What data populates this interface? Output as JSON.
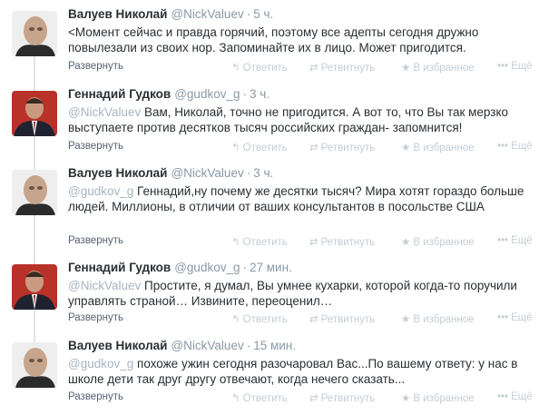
{
  "tweets": [
    {
      "name": "Валуев Николай",
      "handle": "@NickValuev",
      "time": "5 ч.",
      "avatar": "bald-man-avatar",
      "mention": "",
      "text": "<Момент сейчас и правда горячий, поэтому все адепты сегодня дружно повылезали из своих нор. Запоминайте их в лицо. Может пригодится."
    },
    {
      "name": "Геннадий Гудков",
      "handle": "@gudkov_g",
      "time": "3 ч.",
      "avatar": "suited-man-avatar",
      "mention": "@NickValuev",
      "text": "Вам, Николай, точно не пригодится. А вот то, что Вы так мерзко выступаете против десятков тысяч российских граждан- запомнится!"
    },
    {
      "name": "Валуев Николай",
      "handle": "@NickValuev",
      "time": "3 ч.",
      "avatar": "bald-man-avatar",
      "mention": "@gudkov_g",
      "text": "Геннадий,ну почему же десятки тысяч? Мира хотят гораздо больше людей. Миллионы, в отличии от ваших консультантов в посольстве США"
    },
    {
      "name": "Геннадий Гудков",
      "handle": "@gudkov_g",
      "time": "27 мин.",
      "avatar": "suited-man-avatar",
      "mention": "@NickValuev",
      "text": "Простите, я думал, Вы умнее кухарки, которой когда-то поручили управлять страной… Извините, переоценил…"
    },
    {
      "name": "Валуев Николай",
      "handle": "@NickValuev",
      "time": "15 мин.",
      "avatar": "bald-man-avatar",
      "mention": "@gudkov_g",
      "text": "похоже ужин сегодня разочаровал Вас...По вашему ответу: у нас в школе дети так друг другу отвечают, когда нечего сказать..."
    }
  ],
  "actions": {
    "expand": "Развернуть",
    "reply": "Ответить",
    "retweet": "Ретвитнуть",
    "favorite": "В избранное",
    "more": "Ещё"
  },
  "colors": {
    "name": "#292f33",
    "meta": "#8899a6",
    "action": "#c4cdd5",
    "expand": "#556270"
  }
}
